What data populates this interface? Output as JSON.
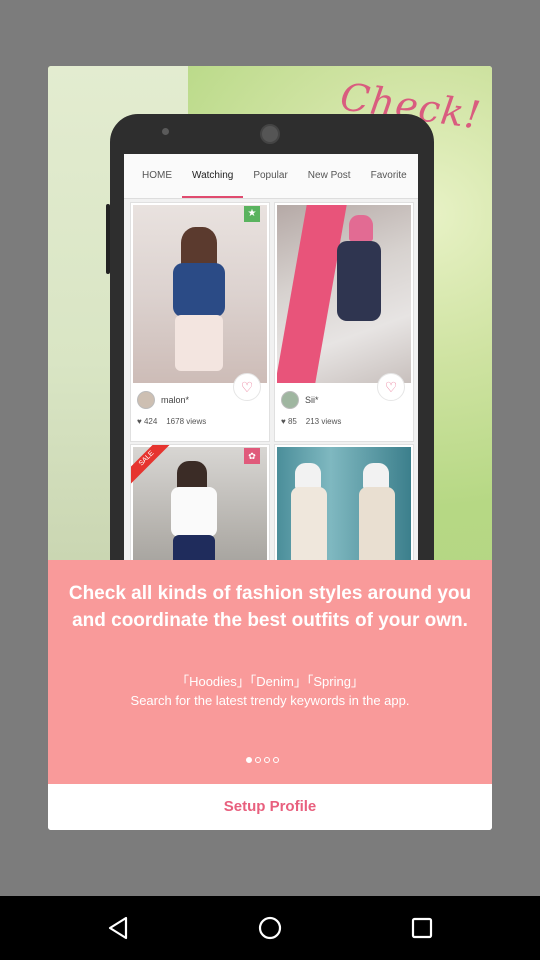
{
  "hero": {
    "check_script": "Check!",
    "tabs": [
      "HOME",
      "Watching",
      "Popular",
      "New Post",
      "Favorite"
    ],
    "active_tab_index": 1,
    "cards": [
      {
        "user": "malon*",
        "likes": "424",
        "views": "1678 views",
        "badge": "star"
      },
      {
        "user": "Sii*",
        "likes": "85",
        "views": "213 views",
        "badge": ""
      },
      {
        "user": "",
        "likes": "",
        "views": "",
        "badge": "sale",
        "badge_text": "SALE"
      },
      {
        "user": "",
        "likes": "",
        "views": "",
        "badge": ""
      }
    ]
  },
  "panel": {
    "headline": "Check all kinds of fashion styles around you and coordinate the best outfits of your own.",
    "keywords_line": "「Hoodies」「Denim」「Spring」",
    "keywords_caption": "Search for the latest trendy keywords in the app.",
    "page_count": 4,
    "active_page": 0
  },
  "setup_button": {
    "label": "Setup Profile"
  },
  "colors": {
    "accent": "#e8607e",
    "panel_bg": "#f99a9a",
    "overlay_bg": "#7c7c7c"
  },
  "nav": {
    "back_icon": "back-triangle-icon",
    "home_icon": "home-circle-icon",
    "recent_icon": "recent-square-icon"
  }
}
